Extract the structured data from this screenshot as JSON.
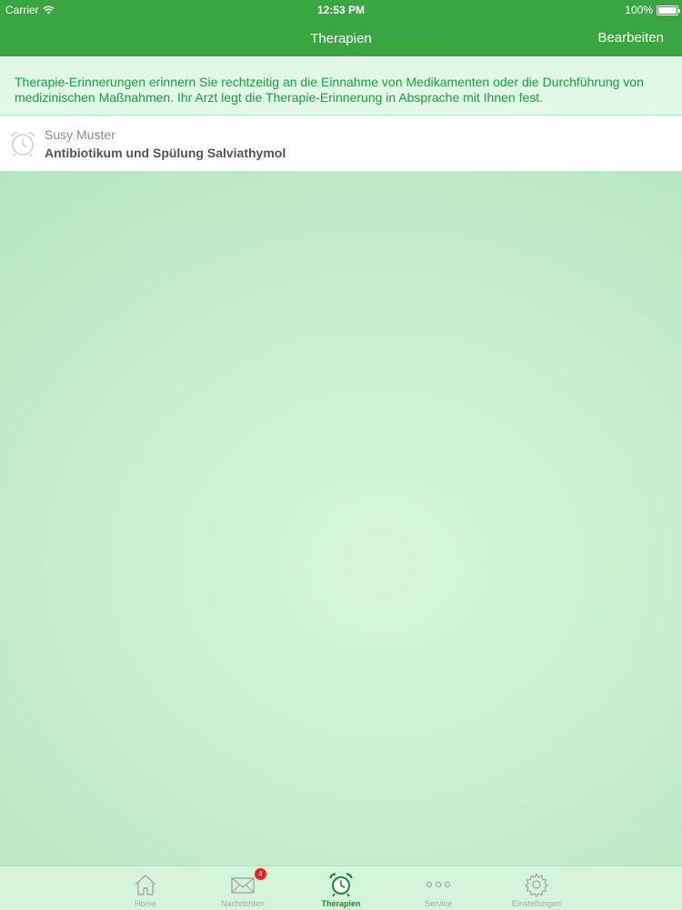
{
  "status_bar": {
    "carrier": "Carrier",
    "time": "12:53 PM",
    "battery": "100%",
    "wifi_icon": "wifi-icon",
    "battery_icon": "battery-icon"
  },
  "nav": {
    "title": "Therapien",
    "edit_label": "Bearbeiten"
  },
  "intro_text": "Therapie-Erinnerungen erinnern Sie rechtzeitig an die Einnahme von Medikamenten oder die Durchführung von medizinischen Maßnahmen. Ihr Arzt legt die Therapie-Erinnerung in Absprache mit Ihnen fest.",
  "therapies": [
    {
      "icon": "alarm-clock-icon",
      "patient": "Susy Muster",
      "description": "Antibiotikum und Spülung Salviathymol"
    }
  ],
  "tab_bar": {
    "tabs": [
      {
        "label": "Home",
        "icon": "home-icon",
        "active": false
      },
      {
        "label": "Nachrichten",
        "icon": "envelope-icon",
        "badge": "4",
        "active": false
      },
      {
        "label": "Therapien",
        "icon": "alarm-clock-icon",
        "active": true
      },
      {
        "label": "Service",
        "icon": "more-dots-icon",
        "active": false
      },
      {
        "label": "Einstellungen",
        "icon": "gear-icon",
        "active": false
      }
    ]
  },
  "colors": {
    "brand_green": "#3aa63f",
    "intro_text": "#18a03a",
    "active_tab": "#1d8a2f",
    "badge_red": "#e8231f"
  }
}
